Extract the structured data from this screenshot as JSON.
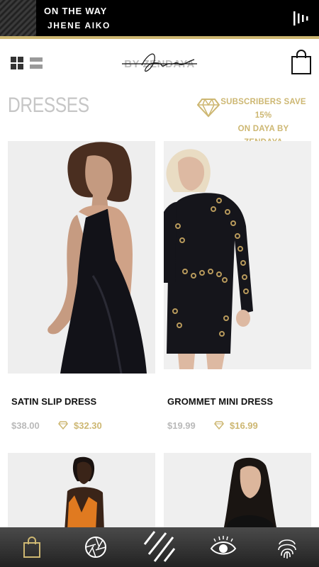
{
  "now_playing": {
    "title": "ON THE WAY",
    "artist": "JHENE AIKO"
  },
  "header": {
    "logo_text": "BY ZENDAYA",
    "logo_signature": "Daya"
  },
  "section": {
    "title": "DRESSES",
    "promo_line1": "SUBSCRIBERS  SAVE 15%",
    "promo_line2": "ON DAYA BY ZENDAYA"
  },
  "products": [
    {
      "name": "SATIN SLIP DRESS",
      "price": "$38.00",
      "subscriber_price": "$32.30"
    },
    {
      "name": "GROMMET MINI DRESS",
      "price": "$19.99",
      "subscriber_price": "$16.99"
    }
  ],
  "colors": {
    "accent_gold": "#cdb772",
    "muted_gray": "#b9b9b9"
  }
}
